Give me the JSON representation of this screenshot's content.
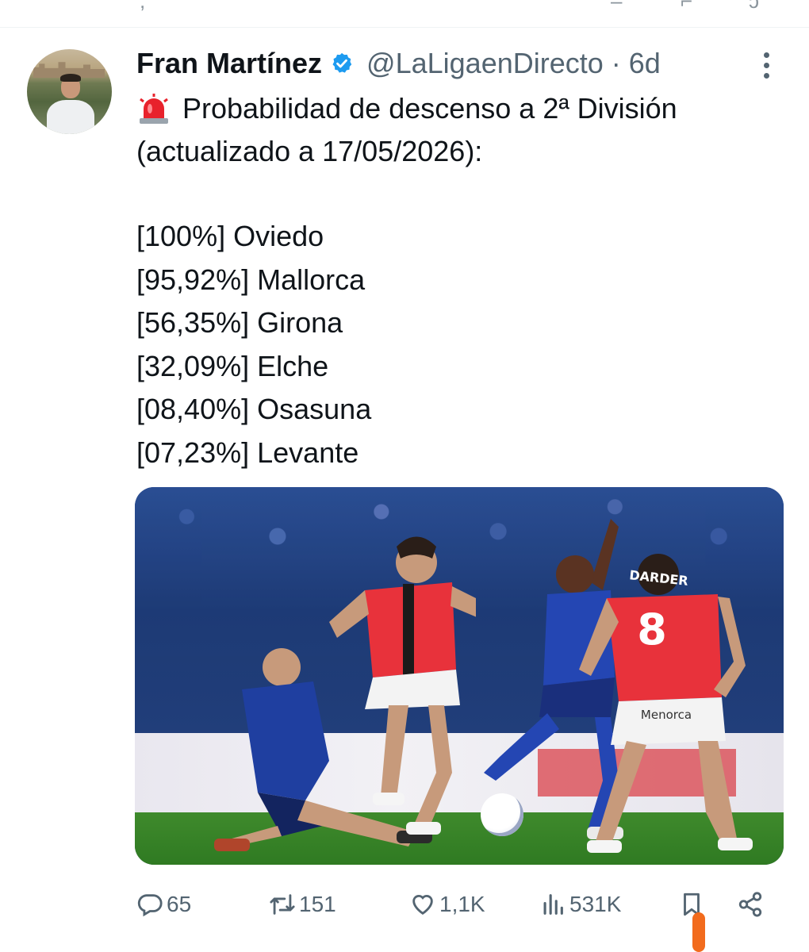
{
  "colors": {
    "text": "#0f1419",
    "secondary": "#536471",
    "verified_blue": "#1d9bf0",
    "accent_orange": "#f26b1d"
  },
  "tweet": {
    "author_name": "Fran Martínez",
    "verified_icon": "verified-badge-icon",
    "handle": "@LaLigaenDirecto",
    "separator": "·",
    "time": "6d",
    "headline_emoji": "🚨",
    "headline_line1": "Probabilidad de descenso a 2ª División",
    "headline_line2": "(actualizado a 17/05/2026):",
    "probabilities": [
      {
        "pct": "[100%]",
        "team": "Oviedo"
      },
      {
        "pct": "[95,92%]",
        "team": "Mallorca"
      },
      {
        "pct": "[56,35%]",
        "team": "Girona"
      },
      {
        "pct": "[32,09%]",
        "team": "Elche"
      },
      {
        "pct": "[08,40%]",
        "team": "Osasuna"
      },
      {
        "pct": "[07,23%]",
        "team": "Levante"
      }
    ],
    "photo_text": {
      "jersey_number": "8",
      "jersey_sponsor": "Menorca",
      "jersey_name": "DARDER"
    }
  },
  "actions": {
    "replies": "65",
    "reposts": "151",
    "likes": "1,1K",
    "views": "531K"
  },
  "icons": [
    "reply-icon",
    "repost-icon",
    "like-icon",
    "views-icon",
    "bookmark-icon",
    "share-icon",
    "more-icon"
  ]
}
